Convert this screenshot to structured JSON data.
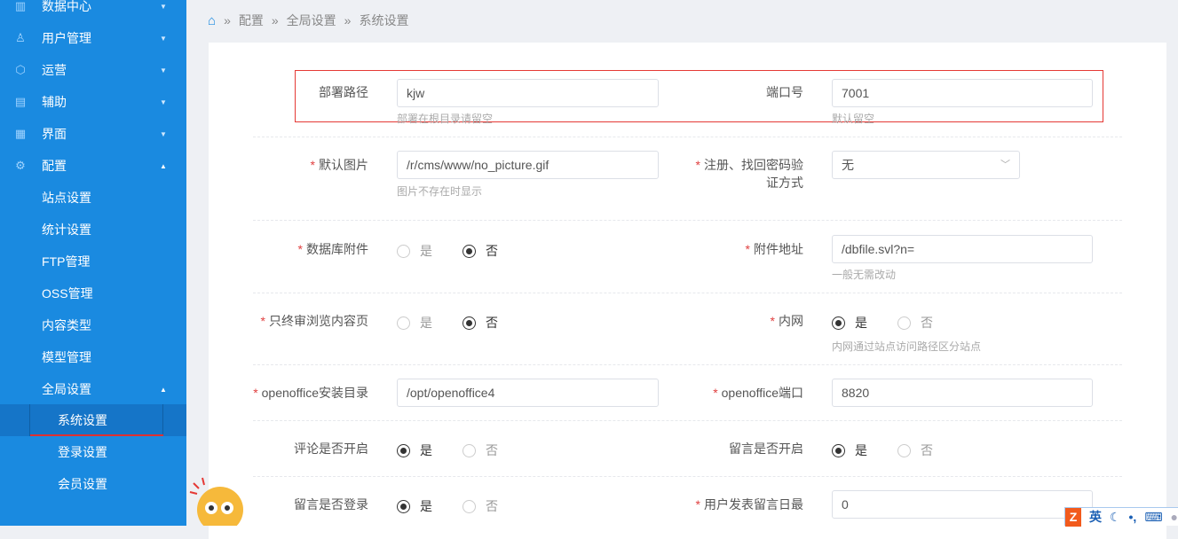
{
  "sidebar": {
    "items": [
      {
        "label": "数据中心",
        "icon": "chart-icon"
      },
      {
        "label": "用户管理",
        "icon": "user-icon"
      },
      {
        "label": "运营",
        "icon": "shield-icon"
      },
      {
        "label": "辅助",
        "icon": "box-icon"
      },
      {
        "label": "界面",
        "icon": "layout-icon"
      },
      {
        "label": "配置",
        "icon": "gear-icon"
      }
    ],
    "config_sub": [
      "站点设置",
      "统计设置",
      "FTP管理",
      "OSS管理",
      "内容类型",
      "模型管理",
      "全局设置"
    ],
    "global_sub": [
      "系统设置",
      "登录设置",
      "会员设置"
    ]
  },
  "breadcrumb": [
    "配置",
    "全局设置",
    "系统设置"
  ],
  "form": {
    "deploy_path": {
      "label": "部署路径",
      "value": "kjw",
      "hint": "部署在根目录请留空"
    },
    "port": {
      "label": "端口号",
      "value": "7001",
      "hint": "默认留空"
    },
    "default_image": {
      "label": "默认图片",
      "value": "/r/cms/www/no_picture.gif",
      "hint": "图片不存在时显示"
    },
    "verify_method": {
      "label1": "注册、找回密码验",
      "label2": "证方式",
      "value": "无"
    },
    "db_attach": {
      "label": "数据库附件",
      "yes": "是",
      "no": "否",
      "selected": "否"
    },
    "attach_url": {
      "label": "附件地址",
      "value": "/dbfile.svl?n=",
      "hint": "一般无需改动"
    },
    "final_review": {
      "label": "只终审浏览内容页",
      "yes": "是",
      "no": "否",
      "selected": "否"
    },
    "intranet": {
      "label": "内网",
      "yes": "是",
      "no": "否",
      "selected": "是",
      "hint": "内网通过站点访问路径区分站点"
    },
    "oo_dir": {
      "label": "openoffice安装目录",
      "value": "/opt/openoffice4"
    },
    "oo_port": {
      "label": "openoffice端口",
      "value": "8820"
    },
    "comment_open": {
      "label": "评论是否开启",
      "yes": "是",
      "no": "否",
      "selected": "是"
    },
    "msg_open": {
      "label": "留言是否开启",
      "yes": "是",
      "no": "否",
      "selected": "是"
    },
    "msg_login": {
      "label": "留言是否登录",
      "yes": "是",
      "no": "否",
      "selected": "是"
    },
    "msg_daily": {
      "label": "用户发表留言日最",
      "value": "0"
    }
  },
  "ime": {
    "mode": "英"
  }
}
